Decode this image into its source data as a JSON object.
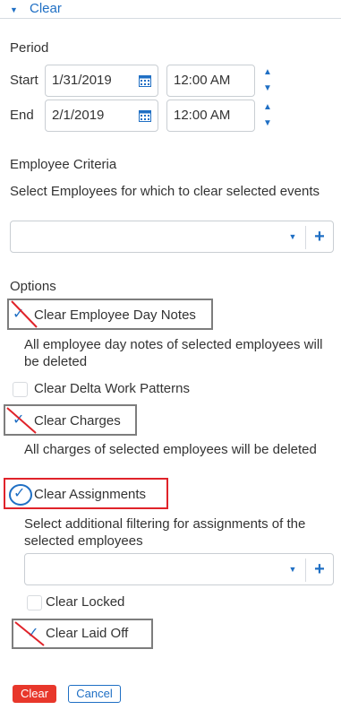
{
  "header": {
    "title": "Clear",
    "caret_icon": "caret-down-icon"
  },
  "period": {
    "heading": "Period",
    "start_label": "Start",
    "start_date": "1/31/2019",
    "start_time": "12:00 AM",
    "end_label": "End",
    "end_date": "2/1/2019",
    "end_time": "12:00 AM"
  },
  "employee_criteria": {
    "heading": "Employee Criteria",
    "description": "Select Employees for which to clear selected events",
    "select_value": ""
  },
  "options": {
    "heading": "Options",
    "clear_employee_day_notes": {
      "label": "Clear Employee Day Notes",
      "checked": true,
      "description": "All employee day notes of selected employees will be deleted"
    },
    "clear_delta_work_patterns": {
      "label": "Clear Delta Work Patterns",
      "checked": false
    },
    "clear_charges": {
      "label": "Clear Charges",
      "checked": true,
      "description": "All charges of selected employees will be deleted"
    },
    "clear_assignments": {
      "label": "Clear Assignments",
      "checked": true,
      "description": "Select additional filtering for assignments of the selected employees"
    },
    "assignments_filter_value": "",
    "clear_locked": {
      "label": "Clear Locked",
      "checked": false
    },
    "clear_laid_off": {
      "label": "Clear Laid Off",
      "checked": true
    }
  },
  "buttons": {
    "clear": "Clear",
    "cancel": "Cancel"
  },
  "colors": {
    "accent": "#1f6fc4",
    "danger": "#e8372b",
    "annotation_red": "#e0232a",
    "annotation_gray": "#7d7d7d"
  }
}
